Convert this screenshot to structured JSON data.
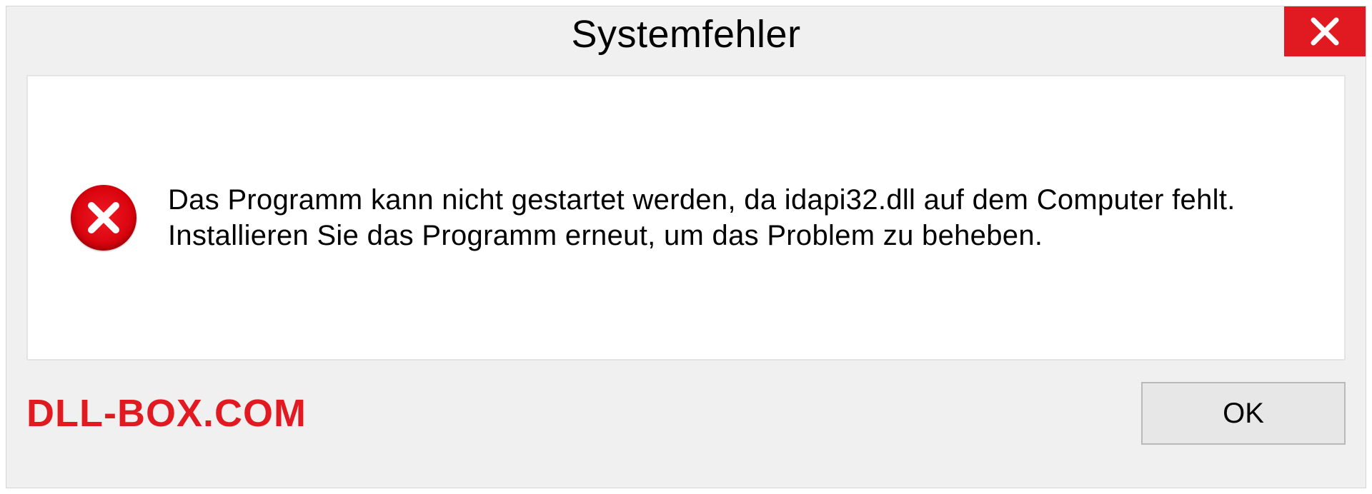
{
  "dialog": {
    "title": "Systemfehler",
    "message": "Das Programm kann nicht gestartet werden, da idapi32.dll auf dem Computer fehlt. Installieren Sie das Programm erneut, um das Problem zu beheben.",
    "ok_label": "OK",
    "watermark": "DLL-BOX.COM"
  },
  "colors": {
    "accent_red": "#e11a22",
    "dialog_bg": "#f0f0f0",
    "content_bg": "#ffffff",
    "button_bg": "#e7e7e7",
    "button_border": "#b9b9b9"
  }
}
